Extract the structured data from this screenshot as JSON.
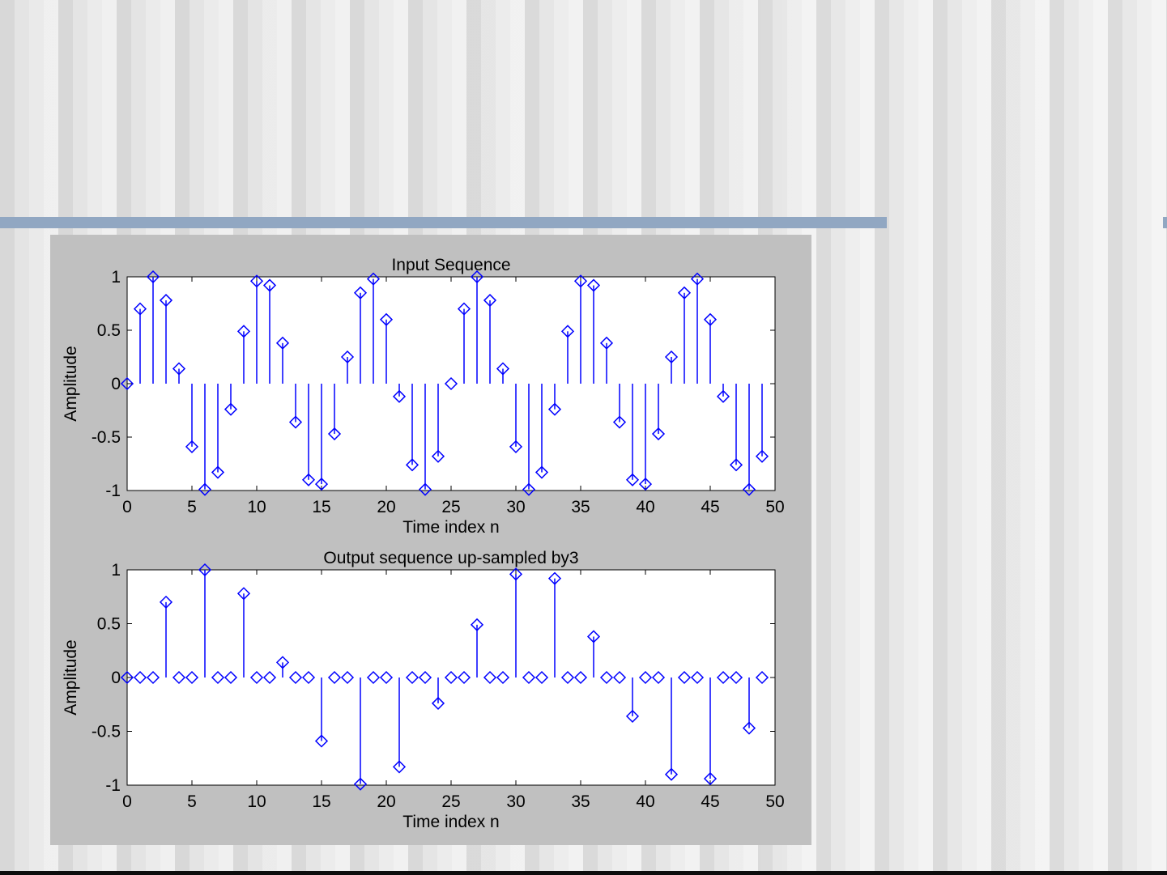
{
  "chart_data": [
    {
      "type": "stem",
      "title": "Input Sequence",
      "xlabel": "Time index n",
      "ylabel": "Amplitude",
      "xlim": [
        0,
        50
      ],
      "ylim": [
        -1,
        1
      ],
      "xticks": [
        "0",
        "5",
        "10",
        "15",
        "20",
        "25",
        "30",
        "35",
        "40",
        "45",
        "50"
      ],
      "yticks": [
        "1",
        "0.5",
        "0",
        "-0.5",
        "-1"
      ],
      "color": "#0000ff",
      "marker": "diamond",
      "x": [
        0,
        1,
        2,
        3,
        4,
        5,
        6,
        7,
        8,
        9,
        10,
        11,
        12,
        13,
        14,
        15,
        16,
        17,
        18,
        19,
        20,
        21,
        22,
        23,
        24,
        25,
        26,
        27,
        28,
        29,
        30,
        31,
        32,
        33,
        34,
        35,
        36,
        37,
        38,
        39,
        40,
        41,
        42,
        43,
        44,
        45,
        46,
        47,
        48,
        49
      ],
      "values": [
        0,
        0.7,
        1.0,
        0.78,
        0.14,
        -0.59,
        -0.99,
        -0.83,
        -0.24,
        0.49,
        0.96,
        0.92,
        0.38,
        -0.36,
        -0.9,
        -0.94,
        -0.47,
        0.25,
        0.85,
        0.98,
        0.6,
        -0.12,
        -0.76,
        -0.99,
        -0.68,
        0,
        0.7,
        1.0,
        0.78,
        0.14,
        -0.59,
        -0.99,
        -0.83,
        -0.24,
        0.49,
        0.96,
        0.92,
        0.38,
        -0.36,
        -0.9,
        -0.94,
        -0.47,
        0.25,
        0.85,
        0.98,
        0.6,
        -0.12,
        -0.76,
        -0.99,
        -0.68
      ]
    },
    {
      "type": "stem",
      "title": "Output sequence up-sampled by3",
      "xlabel": "Time index n",
      "ylabel": "Amplitude",
      "xlim": [
        0,
        50
      ],
      "ylim": [
        -1,
        1
      ],
      "xticks": [
        "0",
        "5",
        "10",
        "15",
        "20",
        "25",
        "30",
        "35",
        "40",
        "45",
        "50"
      ],
      "yticks": [
        "1",
        "0.5",
        "0",
        "-0.5",
        "-1"
      ],
      "color": "#0000ff",
      "marker": "diamond",
      "x": [
        0,
        1,
        2,
        3,
        4,
        5,
        6,
        7,
        8,
        9,
        10,
        11,
        12,
        13,
        14,
        15,
        16,
        17,
        18,
        19,
        20,
        21,
        22,
        23,
        24,
        25,
        26,
        27,
        28,
        29,
        30,
        31,
        32,
        33,
        34,
        35,
        36,
        37,
        38,
        39,
        40,
        41,
        42,
        43,
        44,
        45,
        46,
        47,
        48,
        49
      ],
      "values": [
        0,
        0,
        0,
        0.7,
        0,
        0,
        1.0,
        0,
        0,
        0.78,
        0,
        0,
        0.14,
        0,
        0,
        -0.59,
        0,
        0,
        -0.99,
        0,
        0,
        -0.83,
        0,
        0,
        -0.24,
        0,
        0,
        0.49,
        0,
        0,
        0.96,
        0,
        0,
        0.92,
        0,
        0,
        0.38,
        0,
        0,
        -0.36,
        0,
        0,
        -0.9,
        0,
        0,
        -0.94,
        0,
        0,
        -0.47,
        0
      ]
    }
  ]
}
